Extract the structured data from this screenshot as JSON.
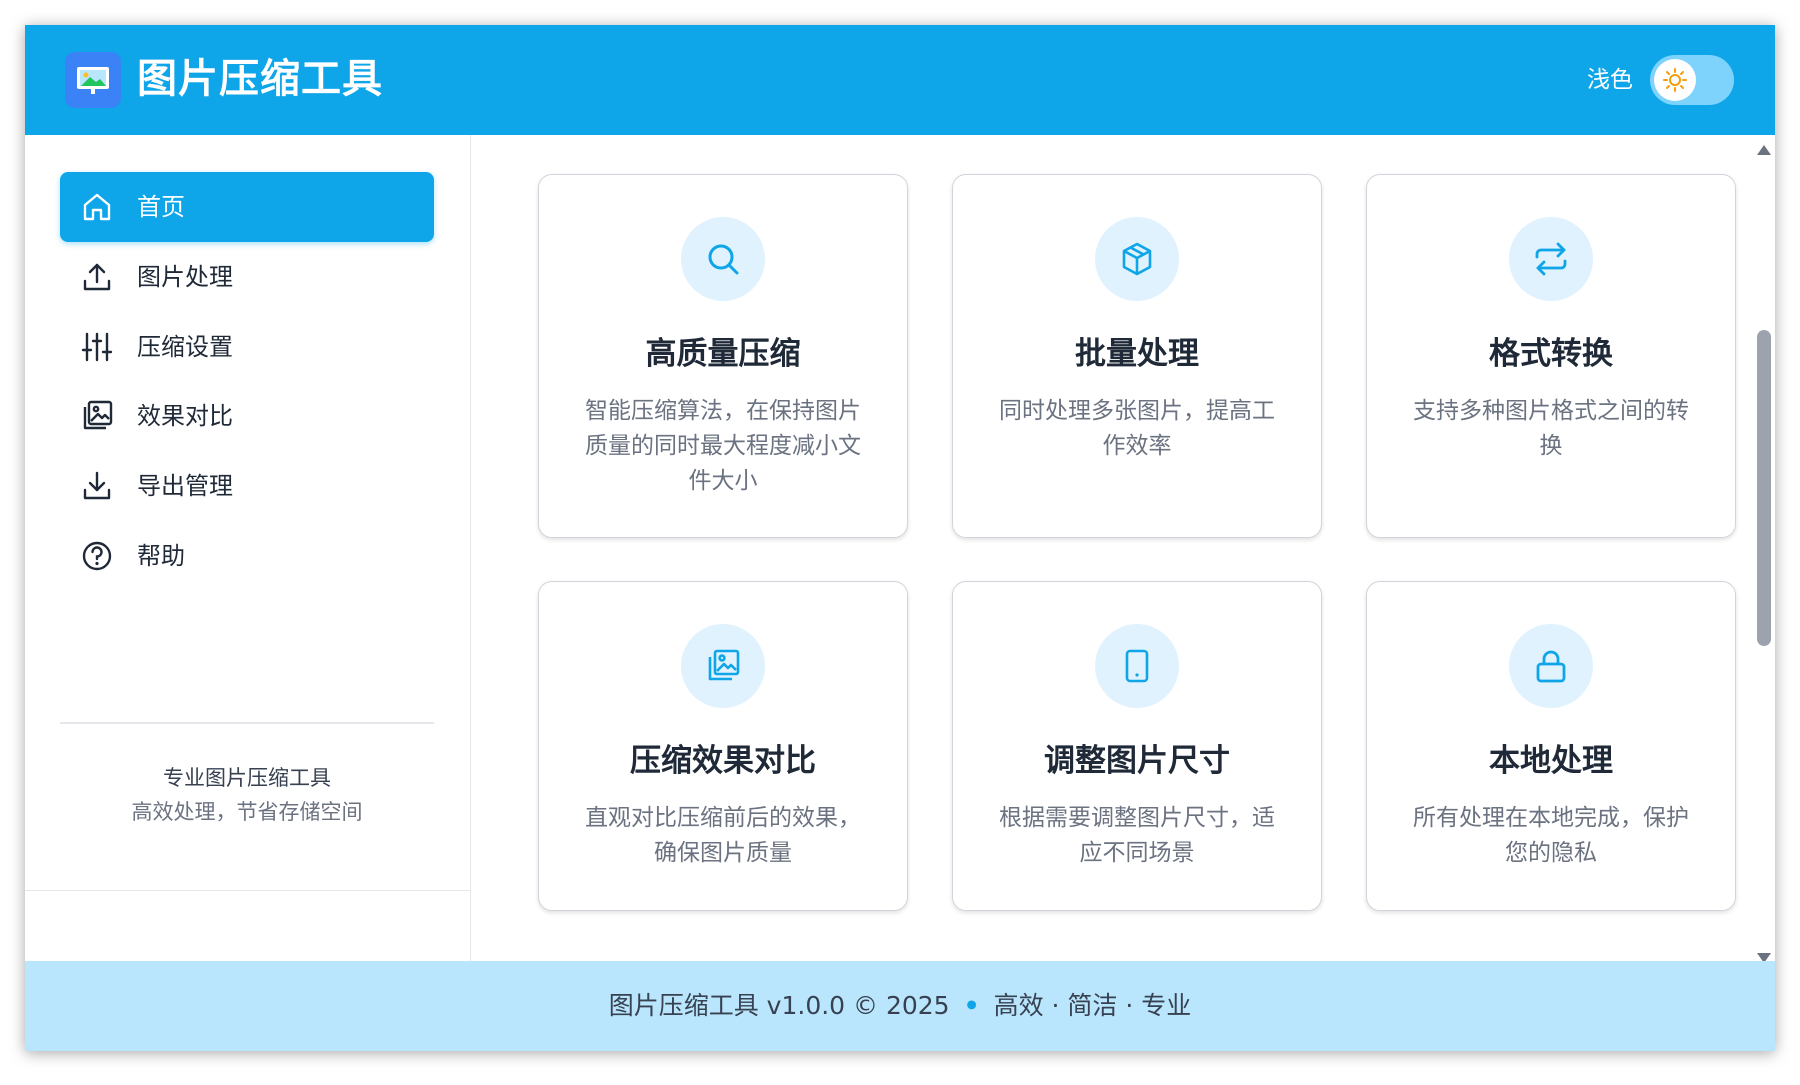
{
  "header": {
    "title": "图片压缩工具",
    "logo_icon": "image-icon",
    "theme_label": "浅色",
    "theme_icon": "sun-icon"
  },
  "sidebar": {
    "items": [
      {
        "label": "首页",
        "icon": "home-icon",
        "active": true
      },
      {
        "label": "图片处理",
        "icon": "upload-icon",
        "active": false
      },
      {
        "label": "压缩设置",
        "icon": "sliders-icon",
        "active": false
      },
      {
        "label": "效果对比",
        "icon": "images-icon",
        "active": false
      },
      {
        "label": "导出管理",
        "icon": "download-icon",
        "active": false
      },
      {
        "label": "帮助",
        "icon": "help-icon",
        "active": false
      }
    ],
    "footer_title": "专业图片压缩工具",
    "footer_subtitle": "高效处理，节省存储空间"
  },
  "features": [
    {
      "title": "高质量压缩",
      "desc": "智能压缩算法，在保持图片质量的同时最大程度减小文件大小",
      "icon": "search-icon"
    },
    {
      "title": "批量处理",
      "desc": "同时处理多张图片，提高工作效率",
      "icon": "cube-icon"
    },
    {
      "title": "格式转换",
      "desc": "支持多种图片格式之间的转换",
      "icon": "arrows-exchange-icon"
    },
    {
      "title": "压缩效果对比",
      "desc": "直观对比压缩前后的效果，确保图片质量",
      "icon": "images-icon"
    },
    {
      "title": "调整图片尺寸",
      "desc": "根据需要调整图片尺寸，适应不同场景",
      "icon": "tablet-icon"
    },
    {
      "title": "本地处理",
      "desc": "所有处理在本地完成，保护您的隐私",
      "icon": "lock-icon"
    }
  ],
  "footer": {
    "left": "图片压缩工具 v1.0.0 © 2025",
    "right": "高效 · 简洁 · 专业"
  },
  "colors": {
    "primary": "#0ea5e9",
    "footer_bg": "#bae6fd",
    "icon_bg": "#e0f2fe"
  }
}
